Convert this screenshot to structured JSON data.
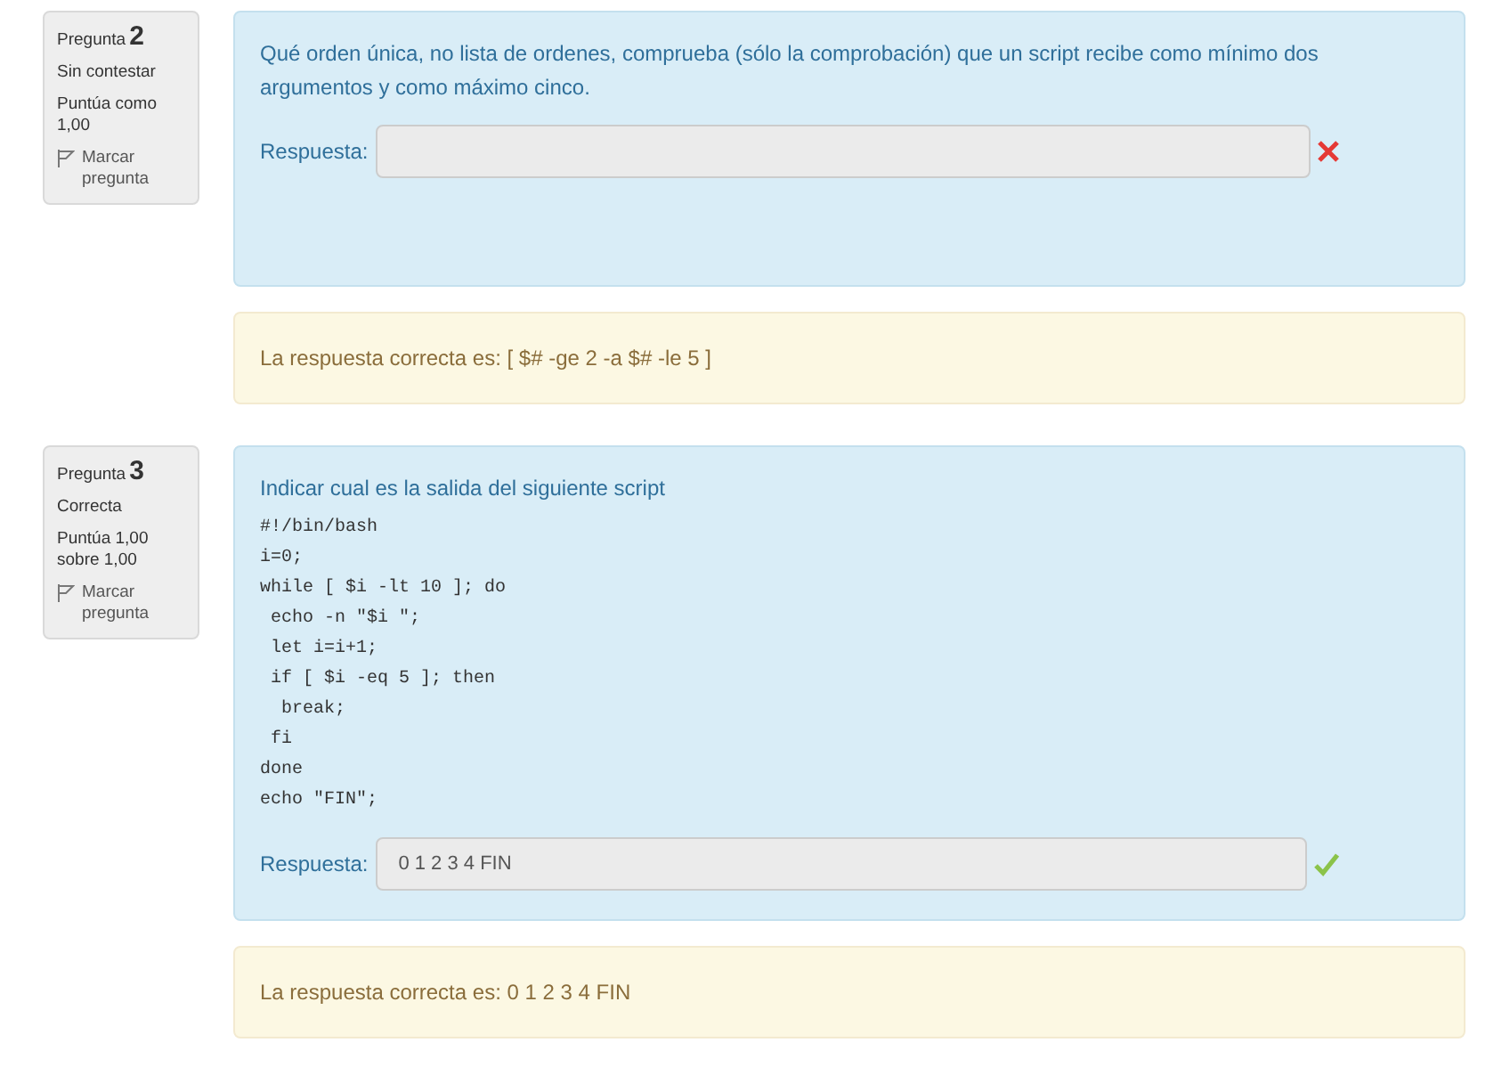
{
  "questions": [
    {
      "label": "Pregunta",
      "number": "2",
      "status": "Sin contestar",
      "grade": "Puntúa como 1,00",
      "flag_label": "Marcar pregunta",
      "prompt": "Qué orden única, no lista de ordenes, comprueba (sólo la comprobación) que un script recibe como mínimo dos argumentos y como máximo cinco.",
      "answer_label": "Respuesta:",
      "kind": "incorrect",
      "feedback": "La respuesta correcta es: [ $# -ge 2 -a $# -le 5 ]"
    },
    {
      "label": "Pregunta",
      "number": "3",
      "status": "Correcta",
      "grade": "Puntúa 1,00 sobre 1,00",
      "flag_label": "Marcar pregunta",
      "prompt": "Indicar cual es la salida del siguiente script",
      "code": [
        "#!/bin/bash",
        "i=0;",
        "while [ $i -lt 10 ]; do",
        " echo -n \"$i \";",
        " let i=i+1;",
        " if [ $i -eq 5 ]; then",
        "  break;",
        " fi",
        "done",
        "echo \"FIN\";"
      ],
      "answer_label": "Respuesta:",
      "answer": "0 1 2 3 4 FIN",
      "kind": "correct",
      "feedback": "La respuesta correcta es: 0 1 2 3 4 FIN"
    }
  ]
}
